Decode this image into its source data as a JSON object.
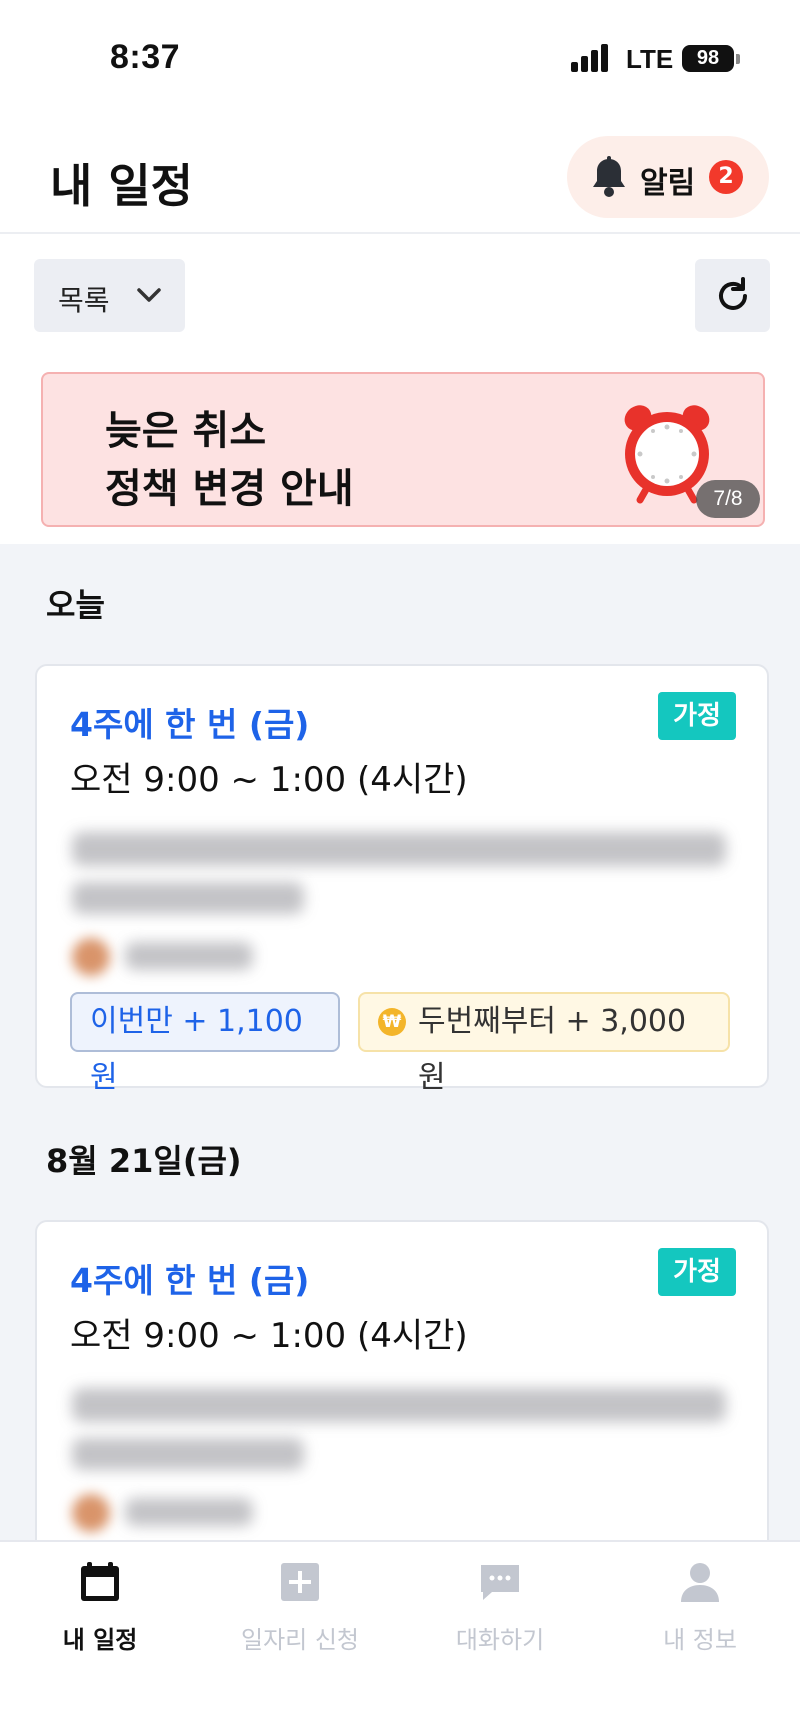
{
  "status_bar": {
    "time": "8:37",
    "network": "LTE",
    "battery": "98"
  },
  "header": {
    "title": "내 일정",
    "alarm_label": "알림",
    "alarm_count": "2"
  },
  "toolbar": {
    "view_label": "목록"
  },
  "banner": {
    "line1": "늦은 취소",
    "line2": "정책 변경 안내",
    "pager": "7/8"
  },
  "sections": [
    {
      "date": "오늘",
      "card": {
        "frequency": "4주에 한 번 (금)",
        "tag": "가정",
        "time": "오전 9:00 ~ 1:00 (4시간)",
        "chip_once": "이번만 + 1,100원",
        "chip_repeat": "두번째부터 + 3,000원",
        "coin_symbol": "₩"
      }
    },
    {
      "date": "8월 21일(금)",
      "card": {
        "frequency": "4주에 한 번 (금)",
        "tag": "가정",
        "time": "오전 9:00 ~ 1:00 (4시간)"
      }
    }
  ],
  "bottom_nav": [
    {
      "label": "내 일정",
      "icon": "calendar-icon",
      "active": true
    },
    {
      "label": "일자리 신청",
      "icon": "plus-square-icon",
      "active": false
    },
    {
      "label": "대화하기",
      "icon": "chat-icon",
      "active": false
    },
    {
      "label": "내 정보",
      "icon": "person-icon",
      "active": false
    }
  ],
  "colors": {
    "accent_blue": "#1e63e8",
    "tag_teal": "#14c7bf",
    "badge_red": "#f2392b",
    "banner_bg": "#fde2e2",
    "list_bg": "#f2f4f8"
  }
}
